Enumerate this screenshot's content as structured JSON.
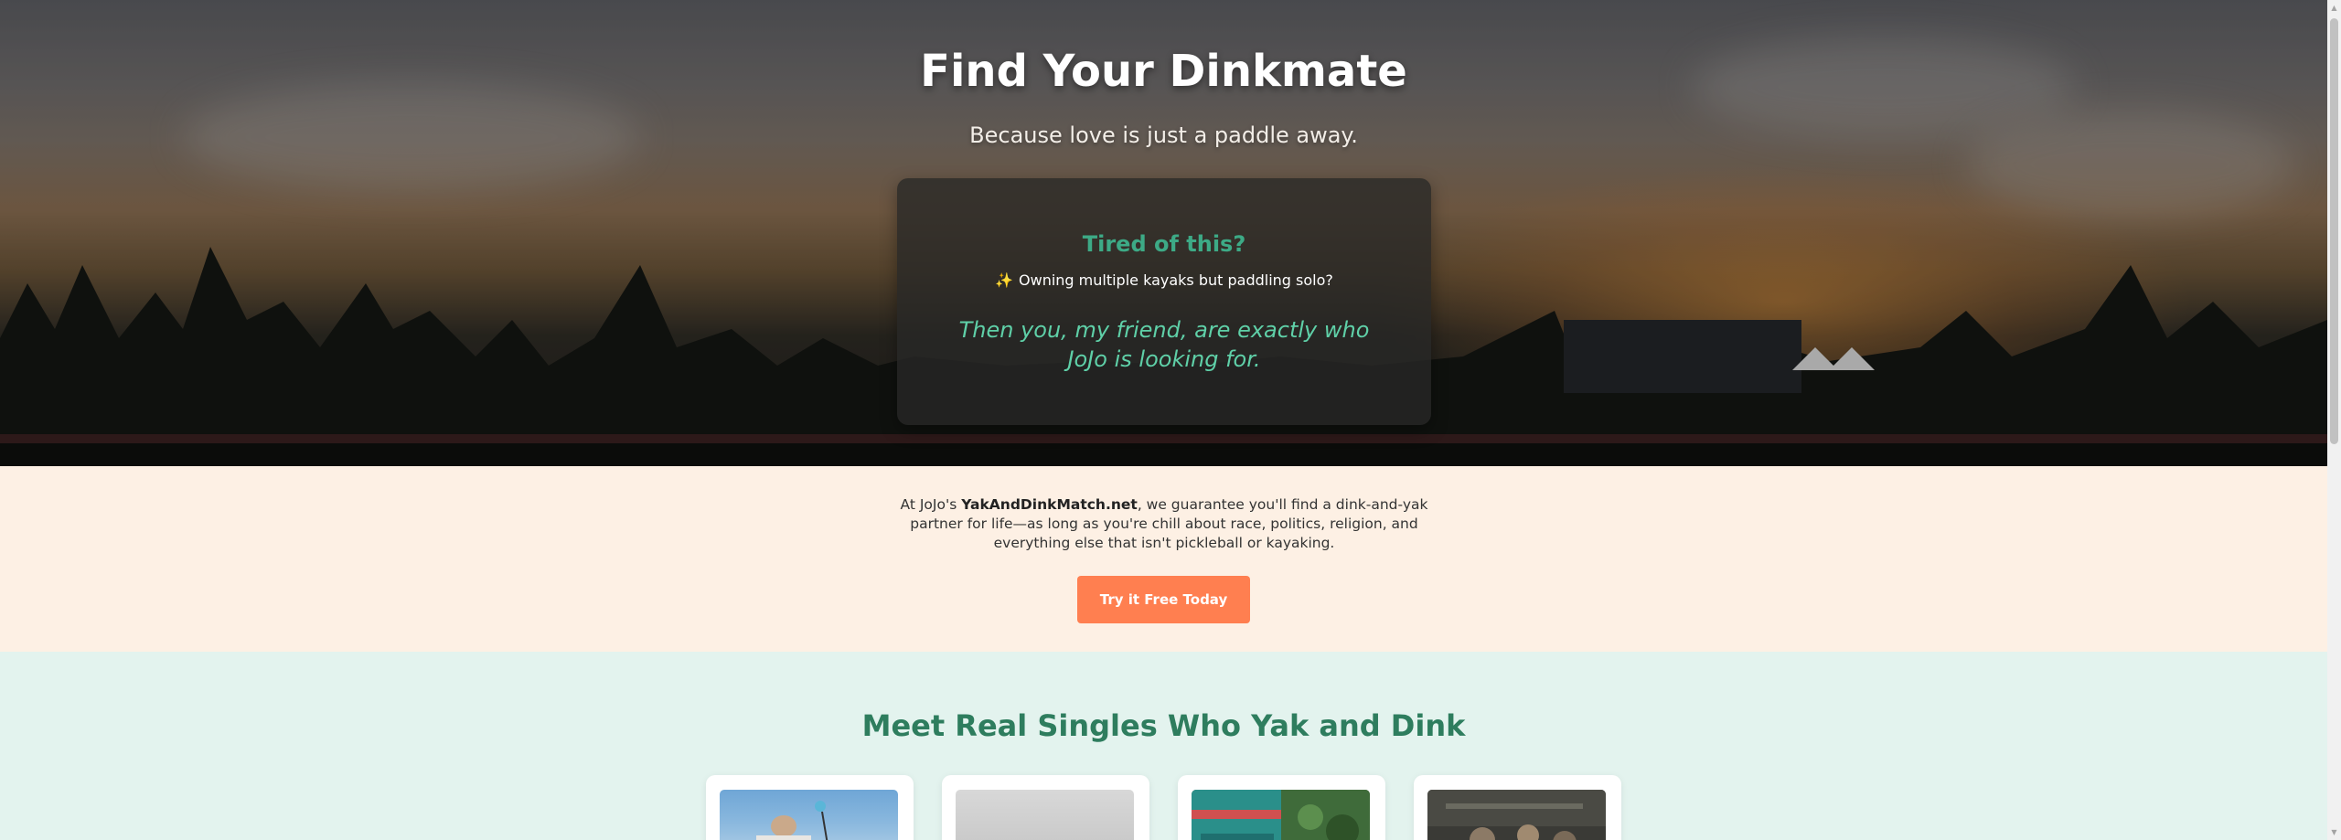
{
  "hero": {
    "title": "Find Your Dinkmate",
    "subtitle": "Because love is just a paddle away."
  },
  "pain_card": {
    "title": "Tired of this?",
    "item_icon": "sparkles-icon",
    "item": "Owning multiple kayaks but paddling solo?",
    "quote": "Then you, my friend, are exactly who JoJo is looking for."
  },
  "intro": {
    "prefix": "At JoJo's ",
    "brand": "YakAndDinkMatch.net",
    "suffix": ", we guarantee you'll find a dink-and-yak partner for life—as long as you're chill about race, politics, religion, and everything else that isn't pickleball or kayaking.",
    "cta_label": "Try it Free Today"
  },
  "singles": {
    "title": "Meet Real Singles Who Yak and Dink"
  },
  "colors": {
    "accent_green": "#2e7d5e",
    "cta_orange": "#ff7f50",
    "cream_bg": "#fdf0e4",
    "mint_bg": "#e3f3ee"
  }
}
